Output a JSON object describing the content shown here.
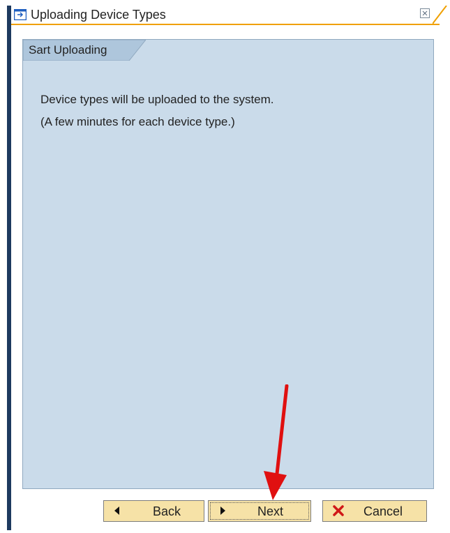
{
  "window": {
    "title": "Uploading Device Types",
    "title_icon": "dialog-window-icon",
    "close_icon": "close-icon"
  },
  "panel": {
    "tab_label": "Sart Uploading",
    "messages": [
      "Device types will be uploaded to the system.",
      "(A few minutes for each device type.)"
    ]
  },
  "buttons": {
    "back": "Back",
    "next": "Next",
    "cancel": "Cancel"
  },
  "colors": {
    "panel_background": "#cadbea",
    "button_background": "#f6e2a7",
    "title_accent": "#f0a000",
    "arrow": "#e01010"
  }
}
